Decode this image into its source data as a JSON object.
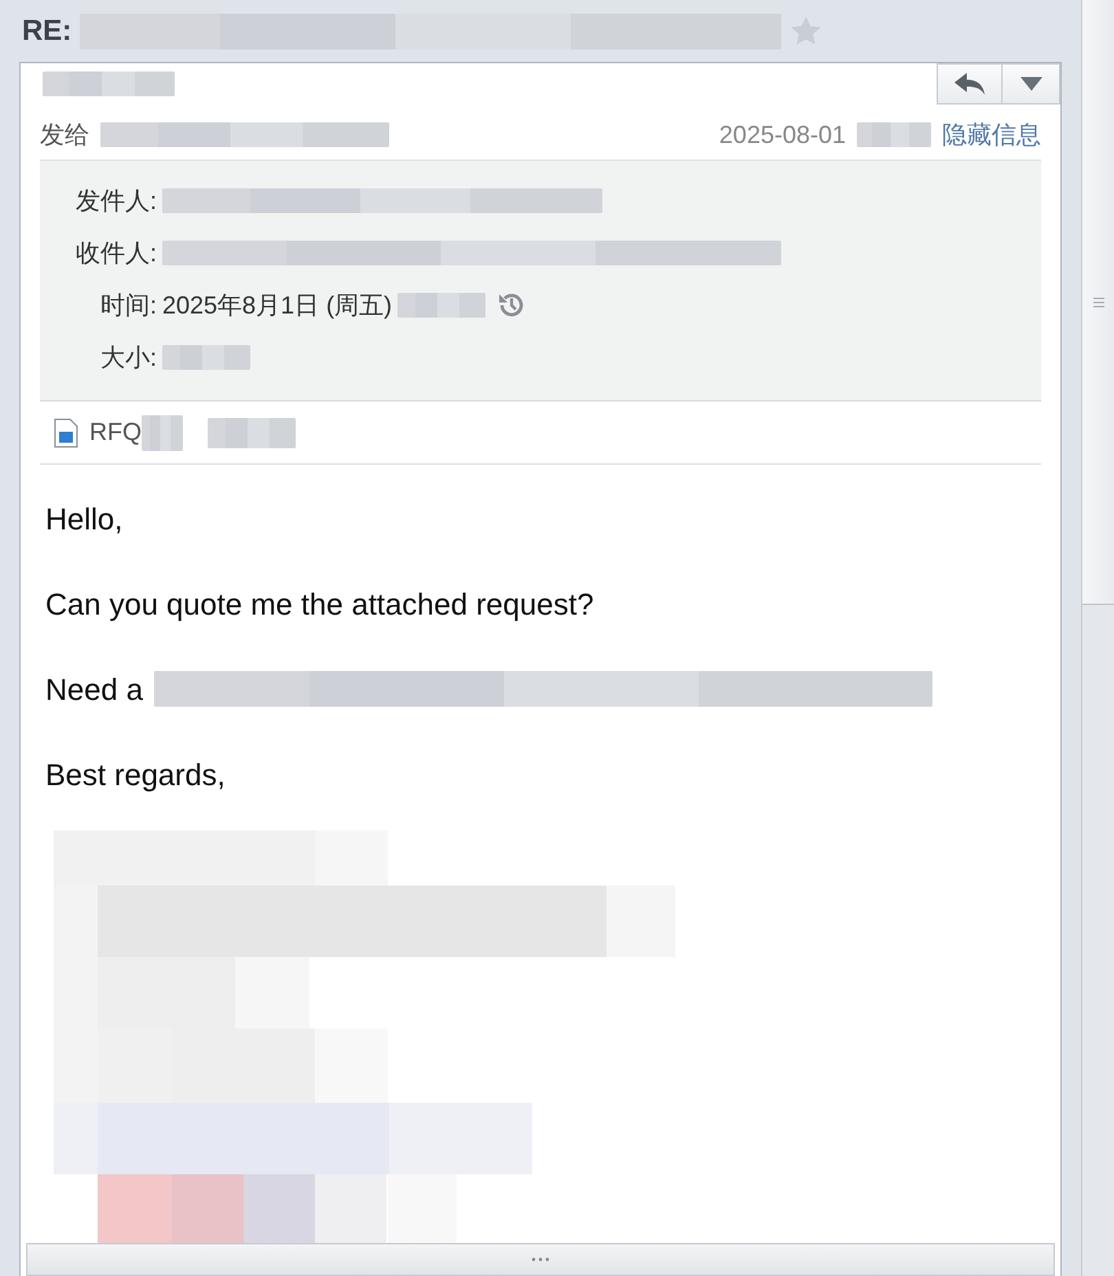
{
  "subject": {
    "prefix": "RE:",
    "starred": false
  },
  "header": {
    "to_label": "发给",
    "date": "2025-08-01",
    "toggle": "隐藏信息"
  },
  "details": [
    {
      "label": "发件人:",
      "redacted": true
    },
    {
      "label": "收件人:",
      "redacted": true
    },
    {
      "label": "时间:",
      "value": "2025年8月1日 (周五)",
      "redacted": true,
      "history": true
    },
    {
      "label": "大小:",
      "redacted": true
    }
  ],
  "attachment": {
    "name": "RFQ"
  },
  "body": [
    {
      "text": "Hello,"
    },
    {
      "text": "Can you quote me the attached request?"
    },
    {
      "text": "Need a",
      "redacted": true
    },
    {
      "text": "Best regards,"
    }
  ]
}
